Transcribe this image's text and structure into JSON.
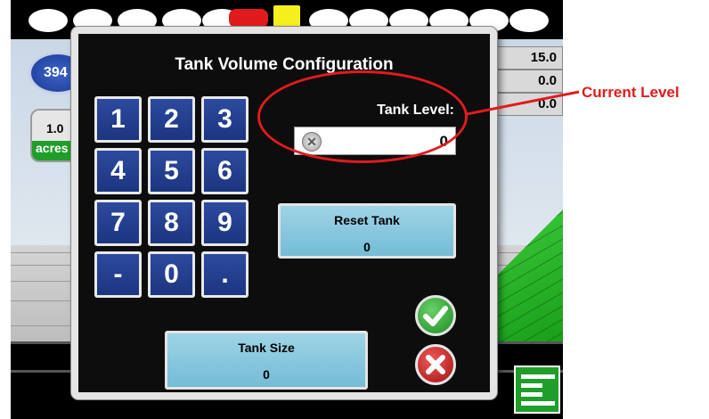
{
  "background": {
    "speed_value": "394",
    "area_value": "1.0",
    "area_unit": "acres",
    "readouts": [
      "15.0",
      "0.0",
      "0.0"
    ]
  },
  "dialog": {
    "title": "Tank Volume Configuration",
    "keypad": [
      "1",
      "2",
      "3",
      "4",
      "5",
      "6",
      "7",
      "8",
      "9",
      "-",
      "0",
      "."
    ],
    "tank_level_label": "Tank Level:",
    "tank_level_value": "0",
    "reset_tank_label": "Reset Tank",
    "reset_tank_value": "0",
    "tank_size_label": "Tank Size",
    "tank_size_value": "0"
  },
  "annotation": {
    "callout_text": "Current Level",
    "color": "#e11b1b"
  },
  "icons": {
    "clear": "clear-icon",
    "confirm": "checkmark-icon",
    "cancel": "close-icon"
  },
  "colors": {
    "key_blue": "#1c3580",
    "teal_button": "#74bcd6",
    "ok_green": "#1e8c23",
    "cancel_red": "#a01212"
  }
}
